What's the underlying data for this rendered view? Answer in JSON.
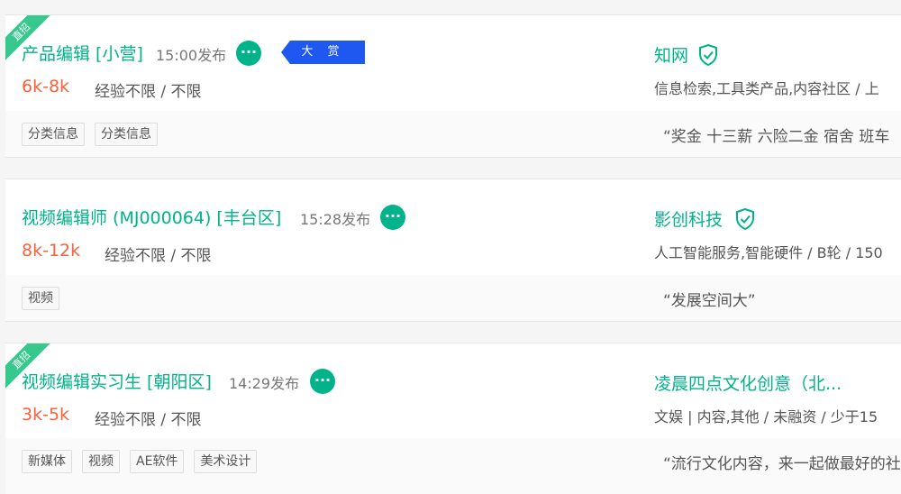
{
  "jobs": [
    {
      "badge": "直招",
      "title": "产品编辑 [小营]",
      "time": "15:00发布",
      "award": "大 赏",
      "salary": "6k-8k",
      "requirements": "经验不限 / 不限",
      "company": "知网",
      "industry": "信息检索,工具类产品,内容社区 / 上",
      "tags": [
        "分类信息",
        "分类信息"
      ],
      "benefits": "“奖金 十三薪 六险二金 宿舍 班车"
    },
    {
      "badge": "",
      "title": "视频编辑师 (MJ000064) [丰台区]",
      "time": "15:28发布",
      "award": "",
      "salary": "8k-12k",
      "requirements": "经验不限 / 不限",
      "company": "影创科技",
      "industry": "人工智能服务,智能硬件 / B轮 / 150",
      "tags": [
        "视频"
      ],
      "benefits": "“发展空间大”"
    },
    {
      "badge": "直招",
      "title": "视频编辑实习生 [朝阳区]",
      "time": "14:29发布",
      "award": "",
      "salary": "3k-5k",
      "requirements": "经验不限 / 不限",
      "company": "凌晨四点文化创意（北...",
      "industry": "文娱 | 内容,其他 / 未融资 / 少于15",
      "tags": [
        "新媒体",
        "视频",
        "AE软件",
        "美术设计"
      ],
      "benefits": "“流行文化内容，来一起做最好的社"
    }
  ]
}
